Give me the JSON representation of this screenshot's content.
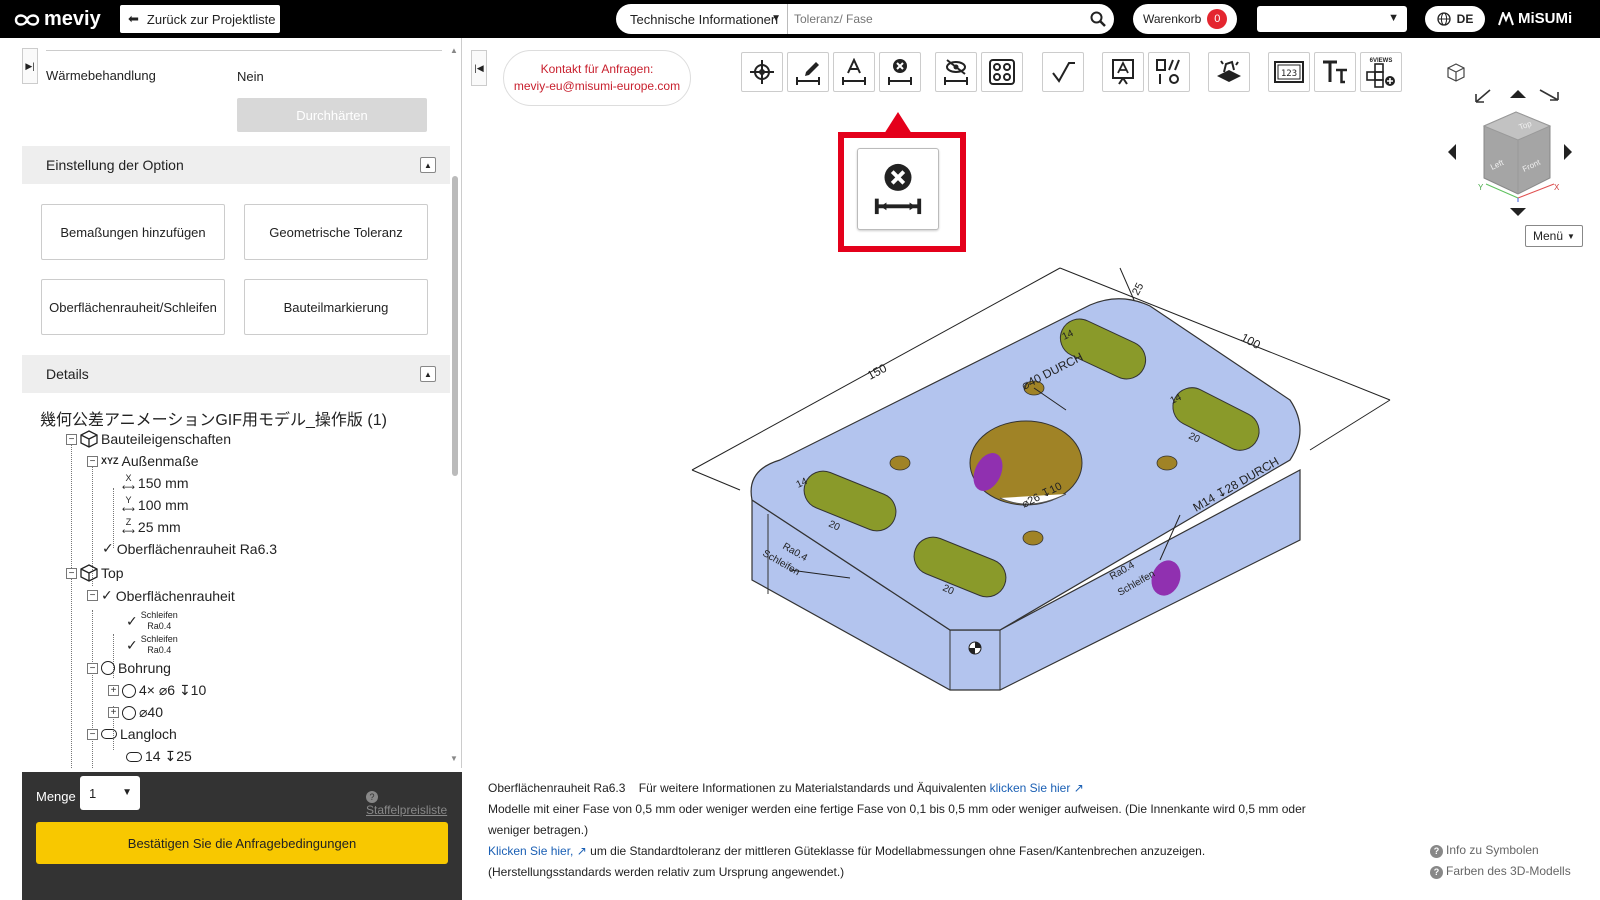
{
  "header": {
    "logo_text": "meviy",
    "back_label": "Zurück zur Projektliste",
    "search_category": "Technische Informationen",
    "search_placeholder": "Toleranz/ Fase",
    "cart_label": "Warenkorb",
    "cart_count": "0",
    "language": "DE",
    "brand": "MiSUMi"
  },
  "left": {
    "heat_label": "Wärmebehandlung",
    "heat_value": "Nein",
    "harden_button": "Durchhärten",
    "options_title": "Einstellung der Option",
    "options": [
      "Bemaßungen hinzufügen",
      "Geometrische Toleranz",
      "Oberflächenrauheit/Schleifen",
      "Bauteilmarkierung"
    ],
    "details_title": "Details",
    "model_name": "幾何公差アニメーションGIF用モデル_操作版 (1)",
    "tree": {
      "part_props": "Bauteileigenschaften",
      "outer": "Außenmaße",
      "outer_icon_label": "XYZ",
      "x_icon": "X",
      "y_icon": "Y",
      "z_icon": "Z",
      "x": "150 mm",
      "y": "100 mm",
      "z": "25 mm",
      "roughness": "Oberflächenrauheit Ra6.3",
      "top": "Top",
      "top_roughness": "Oberflächenrauheit",
      "grind1_a": "Schleifen",
      "grind1_b": "Ra0.4",
      "grind2_a": "Schleifen",
      "grind2_b": "Ra0.4",
      "bohrung": "Bohrung",
      "hole1": "4× ⌀6 ↧10",
      "hole2": "⌀40",
      "langloch": "Langloch",
      "slot1": "14 ↧25"
    }
  },
  "bottom": {
    "menge_label": "Menge",
    "menge_value": "1",
    "staffel": "Staffelpreisliste",
    "confirm": "Bestätigen Sie die Anfragebedingungen"
  },
  "main": {
    "contact_line1": "Kontakt für Anfragen:",
    "contact_line2": "meviy-eu@misumi-europe.com",
    "tools": [
      "crosshair-icon",
      "edit-dimension-icon",
      "text-dimension-icon",
      "remove-dimension-icon",
      "hide-icon",
      "pattern-icon",
      "roughness-icon",
      "annotation-icon",
      "geometric-icon",
      "stamp-icon",
      "numbering-icon",
      "font-icon",
      "six-views-icon"
    ],
    "six_views_label": "6VIEWS",
    "numbering_label": "123",
    "menu_label": "Menü",
    "cube_labels": [
      "Top",
      "Left",
      "Front"
    ],
    "axis_labels": [
      "Y",
      "X"
    ],
    "model_labels": {
      "len150": "150",
      "len100": "100",
      "len25": "25",
      "d40": "⌀40 DURCH",
      "d26": "⌀26 ↧10",
      "m14": "M14 ↧28 DURCH",
      "s14a": "14",
      "s14b": "14",
      "s14c": "14",
      "s20a": "20",
      "s20b": "20",
      "s20c": "20",
      "grind_left": "Schleifen",
      "ra_left": "Ra0.4",
      "grind_right": "Schleifen",
      "ra_right": "Ra0.4"
    },
    "info": {
      "line1_a": "Oberflächenrauheit Ra6.3",
      "line1_b": "Für weitere Informationen zu Materialstandards und Äquivalenten",
      "line1_link": "klicken Sie hier",
      "line2": "Modelle mit einer Fase von 0,5 mm oder weniger werden eine fertige Fase von 0,1 bis 0,5 mm oder weniger aufweisen. (Die Innenkante wird 0,5 mm oder weniger betragen.)",
      "line3_link": "Klicken Sie hier,",
      "line3": "um die Standardtoleranz der mittleren Güteklasse für Modellabmessungen ohne Fasen/Kantenbrechen anzuzeigen.",
      "line4": "(Herstellungsstandards werden relativ zum Ursprung angewendet.)"
    },
    "help1": "Info zu Symbolen",
    "help2": "Farben des 3D-Modells",
    "help_q": "?"
  },
  "colors": {
    "accent": "#f8c800",
    "highlight": "#e4001b",
    "model_face": "#b3c4ee",
    "slot_fill": "#8a9a2a",
    "hole_fill": "#a08326",
    "thread_fill": "#9030b0"
  }
}
